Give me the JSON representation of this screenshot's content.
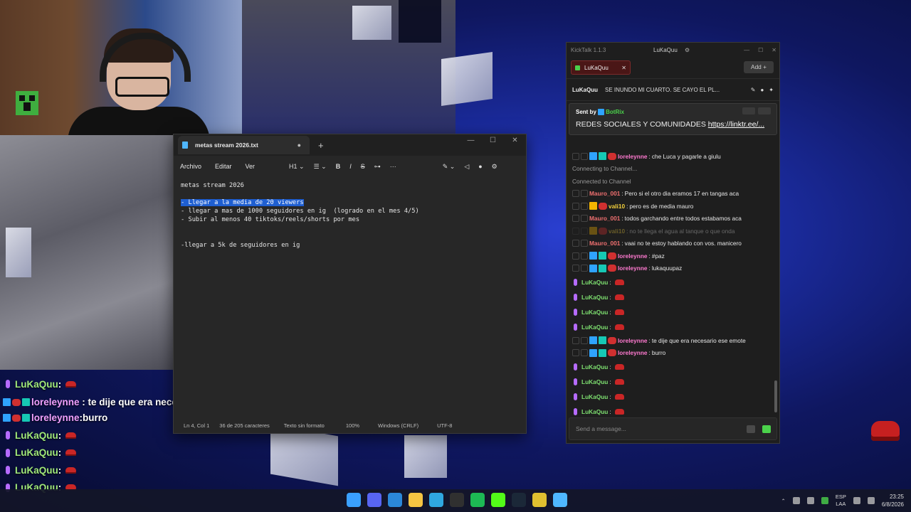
{
  "notepad": {
    "tab_title": "metas stream 2026.txt",
    "menu": [
      "Archivo",
      "Editar",
      "Ver"
    ],
    "heading_tool": "H1",
    "lines": [
      "metas stream 2026",
      "",
      "- Llegar a la media de 20 viewers",
      "- llegar a mas de 1000 seguidores en ig  (logrado en el mes 4/5)",
      "- Subir al menos 40 tiktoks/reels/shorts por mes",
      "",
      "",
      "-llegar a 5k de seguidores en ig"
    ],
    "status": {
      "position": "Ln 4, Col 1",
      "chars": "36 de 205 caracteres",
      "format": "Texto sin formato",
      "zoom": "100%",
      "line_ending": "Windows (CRLF)",
      "encoding": "UTF-8"
    }
  },
  "kicktalk": {
    "app_title": "KickTalk 1.1.3",
    "user": "LuKaQuu",
    "tab_label": "LuKaQuu",
    "add_label": "Add",
    "channel": "LuKaQuu",
    "stream_title": "SE INUNDO MI CUARTO. SE CAYO EL PL...",
    "pinned": {
      "sent_by": "Sent by",
      "bot_name": "BotRix",
      "message": "REDES SOCIALES Y COMUNIDADES ",
      "link": "https://linktr.ee/..."
    },
    "messages": [
      {
        "kind": "user",
        "user": "loreleynne",
        "color": "p",
        "text": "che Luca y pagarle a giulu"
      },
      {
        "kind": "sys",
        "text": "Connecting to Channel..."
      },
      {
        "kind": "sys",
        "text": "Connected to Channel"
      },
      {
        "kind": "user",
        "user": "Mauro_001",
        "color": "r",
        "text": "Pero si el otro dia eramos 17 en tangas aca"
      },
      {
        "kind": "user",
        "user": "vali10",
        "color": "y",
        "text": "pero es de media mauro"
      },
      {
        "kind": "user",
        "user": "Mauro_001",
        "color": "r",
        "text": "todos garchando entre todos estabamos aca"
      },
      {
        "kind": "dim",
        "user": "vali10",
        "color": "y",
        "text": "no te llega el agua al tanque o que onda"
      },
      {
        "kind": "user",
        "user": "Mauro_001",
        "color": "r",
        "text": "vaai no te estoy hablando con vos. manicero"
      },
      {
        "kind": "user",
        "user": "loreleynne",
        "color": "p",
        "text": "#paz"
      },
      {
        "kind": "user",
        "user": "loreleynne",
        "color": "p",
        "text": "lukaquupaz"
      },
      {
        "kind": "lk",
        "user": "LuKaQuu",
        "text": ""
      },
      {
        "kind": "lk",
        "user": "LuKaQuu",
        "text": ""
      },
      {
        "kind": "lk",
        "user": "LuKaQuu",
        "text": ""
      },
      {
        "kind": "lk",
        "user": "LuKaQuu",
        "text": ""
      },
      {
        "kind": "user",
        "user": "loreleynne",
        "color": "p",
        "text": "te dije que era necesario ese emote"
      },
      {
        "kind": "user",
        "user": "loreleynne",
        "color": "p",
        "text": "burro"
      },
      {
        "kind": "lk",
        "user": "LuKaQuu",
        "text": ""
      },
      {
        "kind": "lk",
        "user": "LuKaQuu",
        "text": ""
      },
      {
        "kind": "lk",
        "user": "LuKaQuu",
        "text": ""
      },
      {
        "kind": "lk",
        "user": "LuKaQuu",
        "text": ""
      }
    ],
    "input_placeholder": "Send a message..."
  },
  "overlay_chat": [
    {
      "user": "LuKaQuu",
      "side": "l",
      "text": ""
    },
    {
      "user": "loreleynne",
      "side": "r",
      "text": "te dije que era necesario ese emote"
    },
    {
      "user": "loreleynne",
      "side": "r",
      "text": "burro"
    },
    {
      "user": "LuKaQuu",
      "side": "l",
      "text": ""
    },
    {
      "user": "LuKaQuu",
      "side": "l",
      "text": ""
    },
    {
      "user": "LuKaQuu",
      "side": "l",
      "text": ""
    },
    {
      "user": "LuKaQuu",
      "side": "l",
      "text": ""
    }
  ],
  "taskbar": {
    "lang_top": "ESP",
    "lang_bottom": "LAA",
    "time": "23:25",
    "date": "6/8/2026",
    "apps": [
      "windows-start-icon",
      "discord-icon",
      "store-icon",
      "file-explorer-icon",
      "edge-icon",
      "obs-icon",
      "spotify-icon",
      "kick-icon",
      "steam-icon",
      "minecraft-launcher-icon",
      "notepad-icon"
    ],
    "app_colors": [
      "#3aa0ff",
      "#5865f2",
      "#2b88d8",
      "#f5c542",
      "#2fa7e0",
      "#303030",
      "#1db954",
      "#53fc18",
      "#1b2838",
      "#e0c030",
      "#4fb7ff"
    ]
  },
  "colors": {
    "selection": "#1f5fd1",
    "kick_green": "#53fc18",
    "tab_red": "#4a1616"
  }
}
